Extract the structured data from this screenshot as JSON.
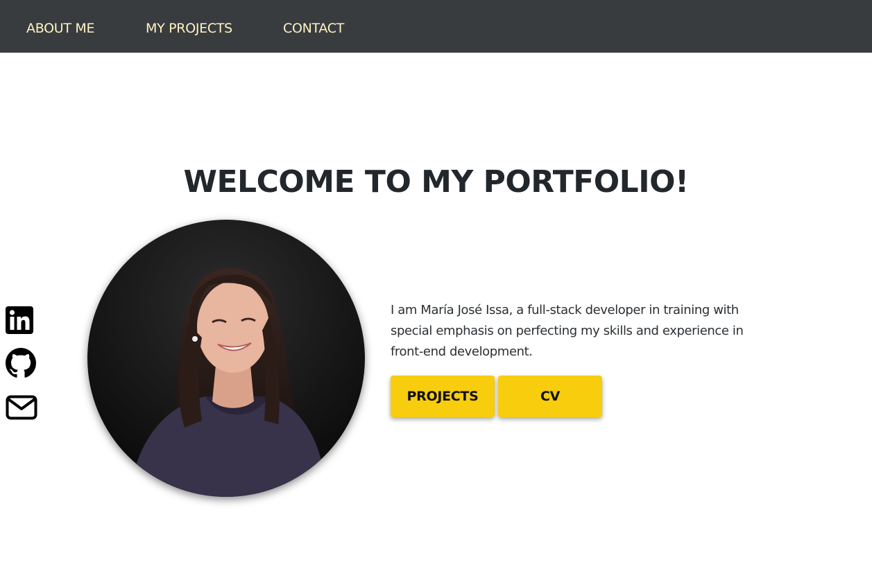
{
  "nav": {
    "items": [
      {
        "label": "ABOUT ME"
      },
      {
        "label": "MY PROJECTS"
      },
      {
        "label": "CONTACT"
      }
    ]
  },
  "hero": {
    "title": "WELCOME TO MY PORTFOLIO!",
    "intro": "I am María José Issa, a full-stack developer in training with special emphasis on perfecting my skills and experience in front-end development.",
    "buttons": {
      "projects_label": "PROJECTS",
      "cv_label": "CV"
    }
  },
  "social": {
    "icons": [
      "linkedin-icon",
      "github-icon",
      "mail-icon"
    ]
  },
  "colors": {
    "navbar_bg": "#393c3f",
    "nav_link": "#fff3c4",
    "accent_button": "#f7cd0e",
    "heading": "#22272c"
  }
}
